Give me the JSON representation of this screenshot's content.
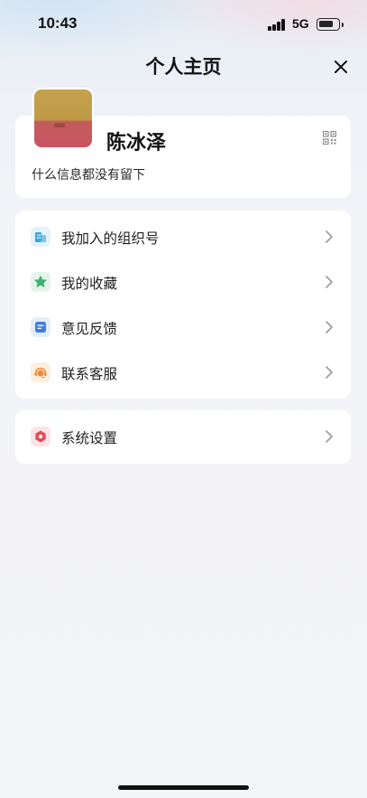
{
  "status_bar": {
    "time": "10:43",
    "network": "5G",
    "signal_bars": 4,
    "battery_level": 0.7
  },
  "header": {
    "title": "个人主页",
    "close_icon": "close-icon"
  },
  "profile": {
    "name": "陈冰泽",
    "bio": "什么信息都没有留下",
    "qr_icon": "qr-code-icon",
    "avatar_colors": [
      "#c5a250",
      "#c95563"
    ]
  },
  "menu": {
    "items": [
      {
        "label": "我加入的组织号",
        "icon": "building-icon",
        "color": "#3ca4d8"
      },
      {
        "label": "我的收藏",
        "icon": "star-icon",
        "color": "#3db06b"
      },
      {
        "label": "意见反馈",
        "icon": "feedback-icon",
        "color": "#3f7fd9"
      },
      {
        "label": "联系客服",
        "icon": "headset-icon",
        "color": "#f08a3c"
      }
    ]
  },
  "settings": {
    "label": "系统设置",
    "icon": "settings-hexagon-icon",
    "color": "#e04b57"
  }
}
